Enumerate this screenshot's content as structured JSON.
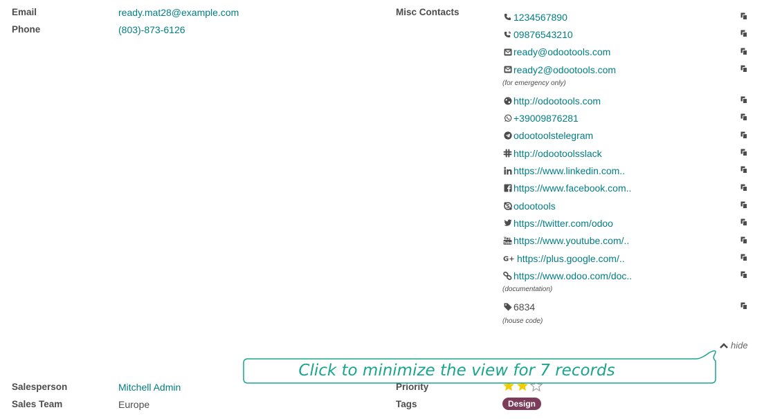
{
  "fields": {
    "email_label": "Email",
    "email_value": "ready.mat28@example.com",
    "phone_label": "Phone",
    "phone_value": "(803)-873-6126",
    "misc_label": "Misc Contacts",
    "salesperson_label": "Salesperson",
    "salesperson_value": "Mitchell Admin",
    "salesteam_label": "Sales Team",
    "salesteam_value": "Europe",
    "priority_label": "Priority",
    "tags_label": "Tags"
  },
  "contacts": [
    {
      "icon": "phone-icon",
      "text": "1234567890"
    },
    {
      "icon": "mobile-icon",
      "text": "09876543210"
    },
    {
      "icon": "envelope-icon",
      "text": "ready@odootools.com"
    },
    {
      "icon": "envelope-icon",
      "text": "ready2@odootools.com",
      "note": "(for emergency only)"
    },
    {
      "icon": "globe-icon",
      "text": "http://odootools.com"
    },
    {
      "icon": "whatsapp-icon",
      "text": "+39009876281"
    },
    {
      "icon": "telegram-icon",
      "text": "odootoolstelegram"
    },
    {
      "icon": "slack-icon",
      "text": "http://odootoolsslack"
    },
    {
      "icon": "linkedin-icon",
      "text": "https://www.linkedin.com.."
    },
    {
      "icon": "facebook-icon",
      "text": "https://www.facebook.com.."
    },
    {
      "icon": "skype-icon",
      "text": "odootools"
    },
    {
      "icon": "twitter-icon",
      "text": "https://twitter.com/odoo"
    },
    {
      "icon": "youtube-icon",
      "text": "https://www.youtube.com/.."
    },
    {
      "icon": "google-plus-icon",
      "text": "https://plus.google.com/.."
    },
    {
      "icon": "link-icon",
      "text": "https://www.odoo.com/doc..",
      "note": "(documentation)"
    },
    {
      "icon": "tag-icon",
      "text": "6834",
      "note": "(house code)",
      "plain": true
    }
  ],
  "hide_label": "hide",
  "callout_text": "Click to minimize the view for 7 records",
  "priority": {
    "value": 2,
    "max": 3
  },
  "tags": [
    "Design"
  ],
  "colors": {
    "link": "#017e84",
    "tag": "#7b3b59",
    "callout": "#1aa58c",
    "star": "#f3cc00"
  }
}
